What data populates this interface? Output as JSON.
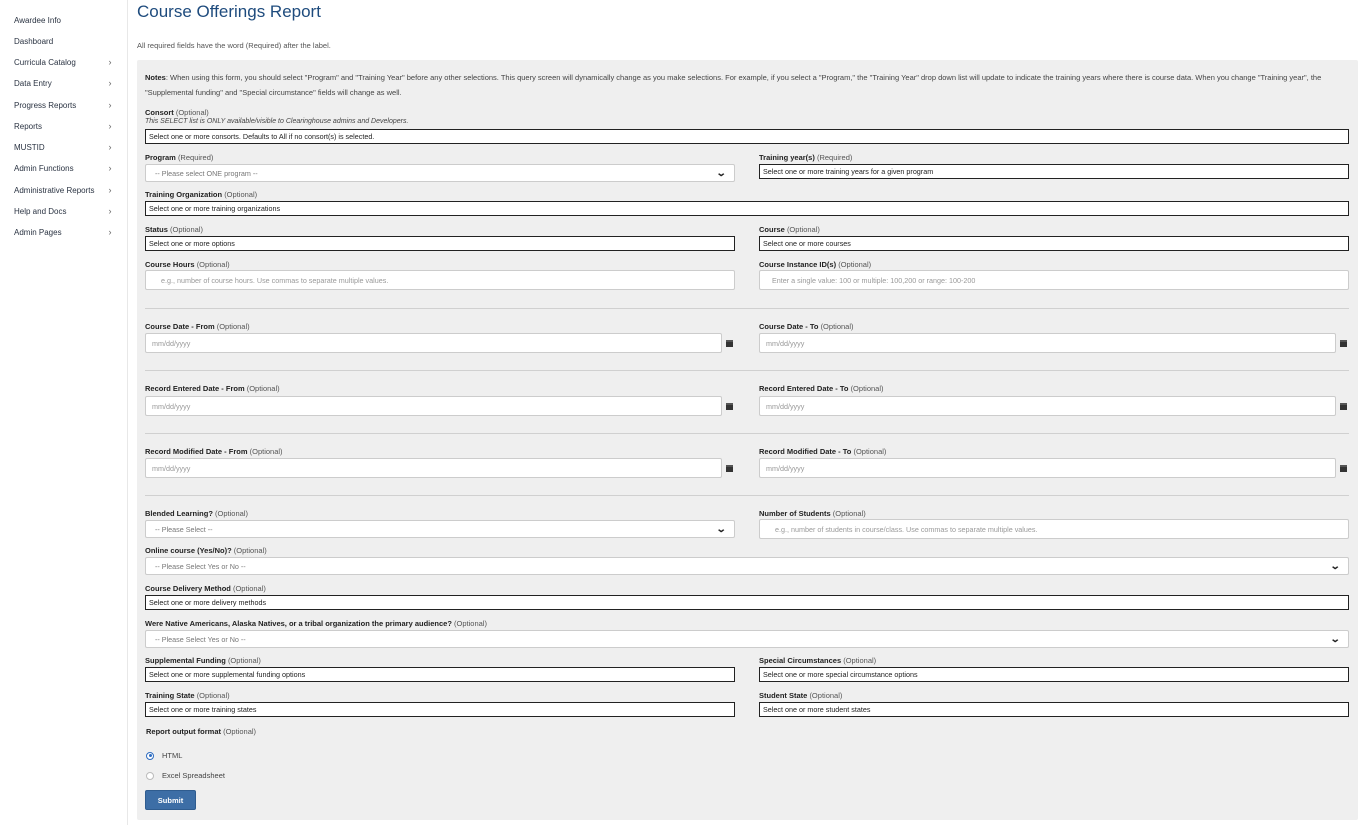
{
  "sidebar": {
    "items": [
      {
        "label": "Awardee Info",
        "chevron": ""
      },
      {
        "label": "Dashboard",
        "chevron": ""
      },
      {
        "label": "Curricula Catalog",
        "chevron": "›"
      },
      {
        "label": "Data Entry",
        "chevron": "›"
      },
      {
        "label": "Progress Reports",
        "chevron": "›"
      },
      {
        "label": "Reports",
        "chevron": "›"
      },
      {
        "label": "MUSTID",
        "chevron": "›"
      },
      {
        "label": "Admin Functions",
        "chevron": "›"
      },
      {
        "label": "Administrative Reports",
        "chevron": "›"
      },
      {
        "label": "Help and Docs",
        "chevron": "›"
      },
      {
        "label": "Admin Pages",
        "chevron": "›"
      }
    ]
  },
  "page": {
    "title": "Course Offerings Report",
    "required_note": "All required fields have the word (Required) after the label."
  },
  "notes": {
    "label": "Notes",
    "text": ": When using this form, you should select \"Program\" and \"Training Year\" before any other selections. This query screen will dynamically change as you make selections. For example, if you select a \"Program,\" the \"Training Year\" drop down list will update to indicate the training years where there is course data. When you change \"Training year\", the \"Supplemental funding\" and \"Special circumstance\" fields will change as well."
  },
  "form": {
    "consort": {
      "label": "Consort",
      "qualifier": "(Optional)",
      "hint": "This SELECT list is ONLY available/visible to Clearinghouse admins and Developers.",
      "placeholder": "Select one or more consorts. Defaults to All if no consort(s) is selected."
    },
    "program": {
      "label": "Program",
      "qualifier": "(Required)",
      "value": "-- Please select ONE program --"
    },
    "training_year": {
      "label": "Training year(s)",
      "qualifier": "(Required)",
      "placeholder": "Select one or more training years for a given program"
    },
    "training_org": {
      "label": "Training Organization",
      "qualifier": "(Optional)",
      "placeholder": "Select one or more training organizations"
    },
    "status": {
      "label": "Status",
      "qualifier": "(Optional)",
      "placeholder": "Select one or more options"
    },
    "course": {
      "label": "Course",
      "qualifier": "(Optional)",
      "placeholder": "Select one or more courses"
    },
    "course_hours": {
      "label": "Course Hours",
      "qualifier": "(Optional)",
      "placeholder": "e.g.,  number of course hours. Use commas to separate multiple values."
    },
    "course_instance": {
      "label": "Course Instance ID(s)",
      "qualifier": "(Optional)",
      "placeholder": "Enter a single value: 100 or multiple: 100,200 or range: 100-200"
    },
    "course_date_from": {
      "label": "Course Date",
      "sep": " - ",
      "bound": "From",
      "qualifier": "(Optional)",
      "placeholder": "mm/dd/yyyy"
    },
    "course_date_to": {
      "label": "Course Date",
      "sep": " - ",
      "bound": "To",
      "qualifier": "(Optional)",
      "placeholder": "mm/dd/yyyy"
    },
    "entered_from": {
      "label": "Record Entered Date",
      "sep": " - ",
      "bound": "From",
      "qualifier": "(Optional)",
      "placeholder": "mm/dd/yyyy"
    },
    "entered_to": {
      "label": "Record Entered Date",
      "sep": " - ",
      "bound": "To",
      "qualifier": "(Optional)",
      "placeholder": "mm/dd/yyyy"
    },
    "modified_from": {
      "label": "Record Modified Date",
      "sep": " - ",
      "bound": "From",
      "qualifier": "(Optional)",
      "placeholder": "mm/dd/yyyy"
    },
    "modified_to": {
      "label": "Record Modified Date",
      "sep": " - ",
      "bound": "To",
      "qualifier": "(Optional)",
      "placeholder": "mm/dd/yyyy"
    },
    "blended": {
      "label": "Blended Learning?",
      "qualifier": "(Optional)",
      "value": "-- Please Select --"
    },
    "num_students": {
      "label": "Number of Students",
      "qualifier": "(Optional)",
      "placeholder": "e.g.,  number of students in course/class. Use commas to separate multiple values."
    },
    "online": {
      "label": "Online course (Yes/No)?",
      "qualifier": "(Optional)",
      "value": "-- Please Select Yes or No --"
    },
    "delivery": {
      "label": "Course Delivery Method",
      "qualifier": "(Optional)",
      "placeholder": "Select one or more delivery methods"
    },
    "native": {
      "label": "Were Native Americans, Alaska Natives, or a tribal organization the primary audience?",
      "qualifier": "(Optional)",
      "value": "-- Please Select Yes or No --"
    },
    "supplemental": {
      "label": "Supplemental Funding",
      "qualifier": "(Optional)",
      "placeholder": "Select one or more supplemental funding options"
    },
    "special": {
      "label": "Special Circumstances",
      "qualifier": "(Optional)",
      "placeholder": "Select one or more special circumstance options"
    },
    "training_state": {
      "label": "Training State",
      "qualifier": "(Optional)",
      "placeholder": "Select one or more training states"
    },
    "student_state": {
      "label": "Student State",
      "qualifier": "(Optional)",
      "placeholder": "Select one or more student states"
    },
    "output": {
      "label": "Report output format",
      "qualifier": "(Optional)",
      "options": [
        "HTML",
        "Excel Spreadsheet"
      ],
      "selected": "HTML"
    },
    "submit_label": "Submit"
  }
}
